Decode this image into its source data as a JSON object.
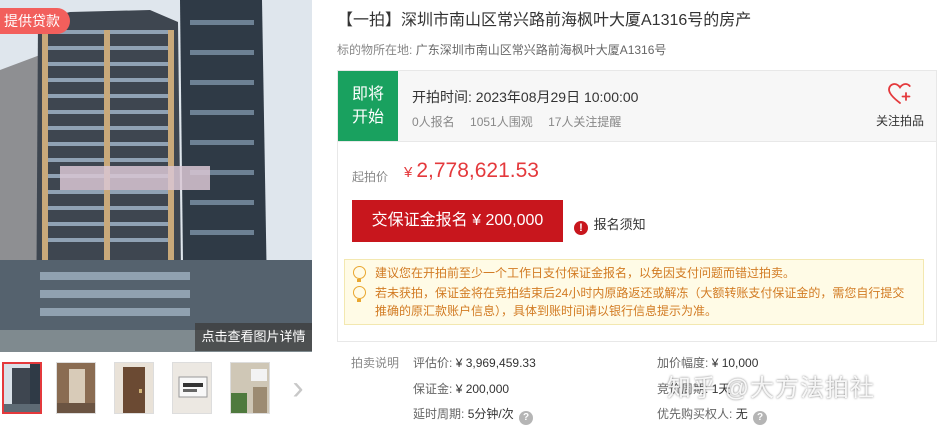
{
  "gallery": {
    "loan_badge": "提供贷款",
    "view_detail": "点击查看图片详情",
    "thumbnails": [
      "楼盘外观",
      "楼道",
      "房门",
      "门牌1316",
      "门牌13F"
    ],
    "next_icon": "chevron-right-icon"
  },
  "lot": {
    "title": "【一拍】深圳市南山区常兴路前海枫叶大厦A1316号的房产",
    "location_label": "标的物所在地:",
    "location_value": "广东深圳市南山区常兴路前海枫叶大厦A1316号"
  },
  "status": {
    "tag_line1": "即将",
    "tag_line2": "开始",
    "start_time_label": "开拍时间:",
    "start_time_value": "2023年08月29日 10:00:00",
    "signup_count": "0人报名",
    "viewers": "1051人围观",
    "followers": "17人关注提醒",
    "follow_label": "关注拍品",
    "follow_icon": "heart-plus-icon"
  },
  "price": {
    "start_label": "起拍价",
    "currency": "¥",
    "start_value": "2,778,621.53",
    "deposit_button": "交保证金报名 ¥ 200,000",
    "notice_link": "报名须知",
    "notice_icon": "exclamation-circle-icon"
  },
  "tips": [
    "建议您在开拍前至少一个工作日支付保证金报名，以免因支付问题而错过拍卖。",
    "若未获拍，保证金将在竞拍结束后24小时内原路返还或解冻（大额转账支付保证金的，需您自行提交推确的原汇款账户信息），具体到账时间请以银行信息提示为准。"
  ],
  "info": {
    "section_label": "拍卖说明",
    "appraisal_label": "评估价:",
    "appraisal_value": "¥ 3,969,459.33",
    "increment_label": "加价幅度:",
    "increment_value": "¥ 10,000",
    "deposit_label": "保证金:",
    "deposit_value": "¥ 200,000",
    "cycle_label": "竞价周期:",
    "cycle_value": "1天",
    "delay_label": "延时周期:",
    "delay_value": "5分钟/次",
    "priority_label": "优先购买权人:",
    "priority_value": "无"
  },
  "watermark": "知乎 @大方法拍社",
  "colors": {
    "accent_red": "#e4393c",
    "button_red": "#c8161d",
    "status_green": "#19a15f",
    "tip_orange": "#d27b23"
  }
}
